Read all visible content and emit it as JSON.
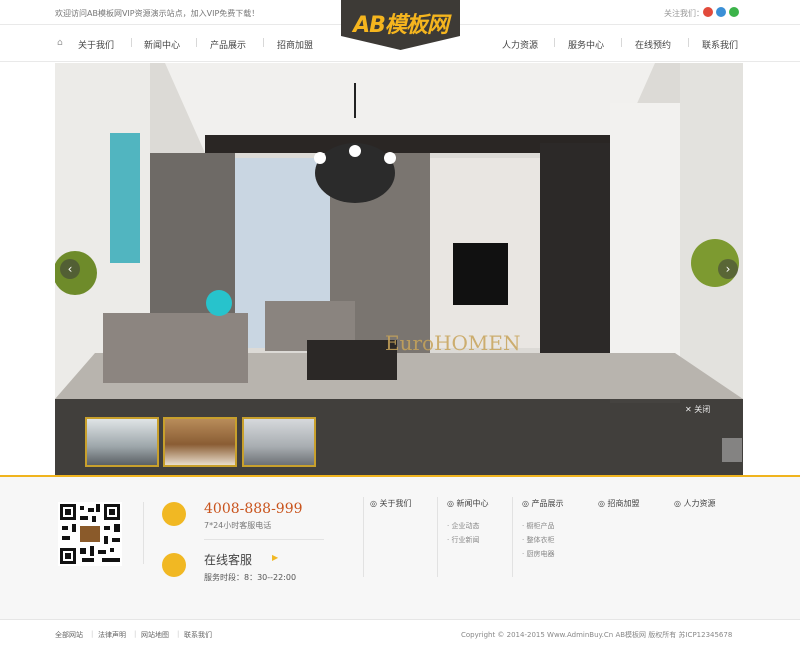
{
  "topbar": {
    "welcome": "欢迎访问AB模板网VIP资源演示站点，加入VIP免费下载！",
    "follow": "关注我们：",
    "social": [
      {
        "name": "weibo-icon",
        "color": "#e24a3b"
      },
      {
        "name": "tencent-icon",
        "color": "#3b8fd6"
      },
      {
        "name": "wechat-icon",
        "color": "#3cb34a"
      }
    ]
  },
  "logo": {
    "text": "AB模板网"
  },
  "nav": {
    "home_icon": "⌂",
    "left": [
      "关于我们",
      "新闻中心",
      "产品展示",
      "招商加盟"
    ],
    "right": [
      "人力资源",
      "服务中心",
      "在线预约",
      "联系我们"
    ]
  },
  "hero": {
    "watermark": "EuroHOMEN",
    "prev": "‹",
    "next": "›",
    "close_label": "✕ 关闭"
  },
  "footer": {
    "phone": "4008-888-999",
    "phone_sub": "7*24小时客服电话",
    "online": "在线客服",
    "online_arrow": "▶",
    "hours": "服务时段：8：30--22:00",
    "columns": [
      {
        "title": "关于我们",
        "items": []
      },
      {
        "title": "新闻中心",
        "items": [
          "企业动态",
          "行业新闻"
        ]
      },
      {
        "title": "产品展示",
        "items": [
          "橱柜产品",
          "整体衣柜",
          "厨房电器"
        ]
      },
      {
        "title": "招商加盟",
        "items": []
      },
      {
        "title": "人力资源",
        "items": []
      }
    ]
  },
  "bottombar": {
    "links": [
      "全部网站",
      "法律声明",
      "网站地图",
      "联系我们"
    ],
    "copyright": "Copyright © 2014-2015 Www.AdminBuy.Cn AB模板网 版权所有 苏ICP12345678"
  }
}
